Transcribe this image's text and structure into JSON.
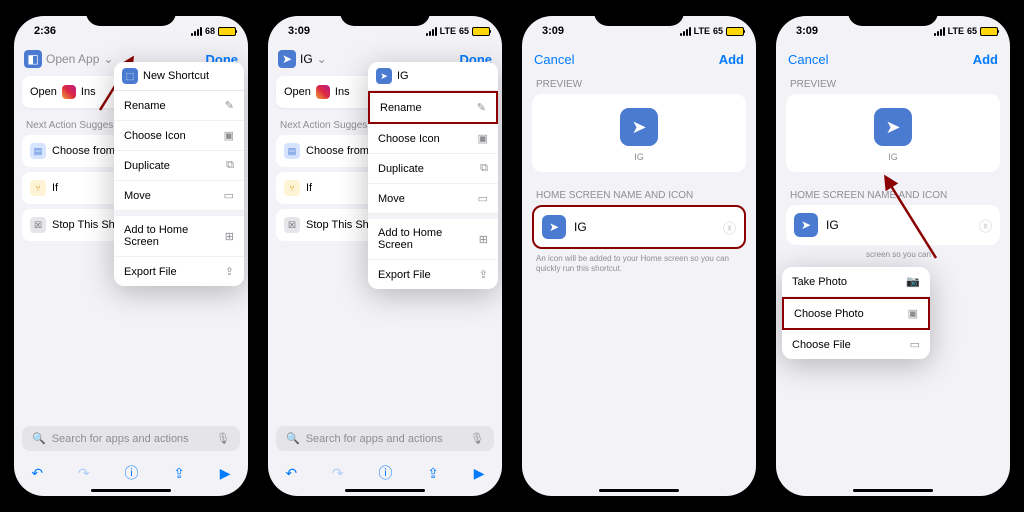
{
  "status": {
    "time1": "2:36",
    "time2": "3:09",
    "lte": "LTE",
    "battery": "68",
    "bat65": "65"
  },
  "header": {
    "done": "Done",
    "cancel": "Cancel",
    "add": "Add",
    "open_app": "Open App",
    "ig": "IG"
  },
  "shortcut": {
    "open": "Open",
    "ins": "Ins",
    "new": "New Shortcut",
    "ig": "IG"
  },
  "section": {
    "next": "Next Action Sugges"
  },
  "sugg": {
    "choose": "Choose from M",
    "if": "If",
    "stop": "Stop This Sho"
  },
  "menu": {
    "rename": "Rename",
    "choose_icon": "Choose Icon",
    "duplicate": "Duplicate",
    "move": "Move",
    "add_home": "Add to Home Screen",
    "export": "Export File"
  },
  "search": {
    "placeholder": "Search for apps and actions"
  },
  "preview": {
    "label": "PREVIEW",
    "home_label": "HOME SCREEN NAME AND ICON",
    "name": "IG",
    "help": "An icon will be added to your Home screen so you can quickly run this shortcut."
  },
  "photo_menu": {
    "take": "Take Photo",
    "choose": "Choose Photo",
    "file": "Choose File"
  }
}
